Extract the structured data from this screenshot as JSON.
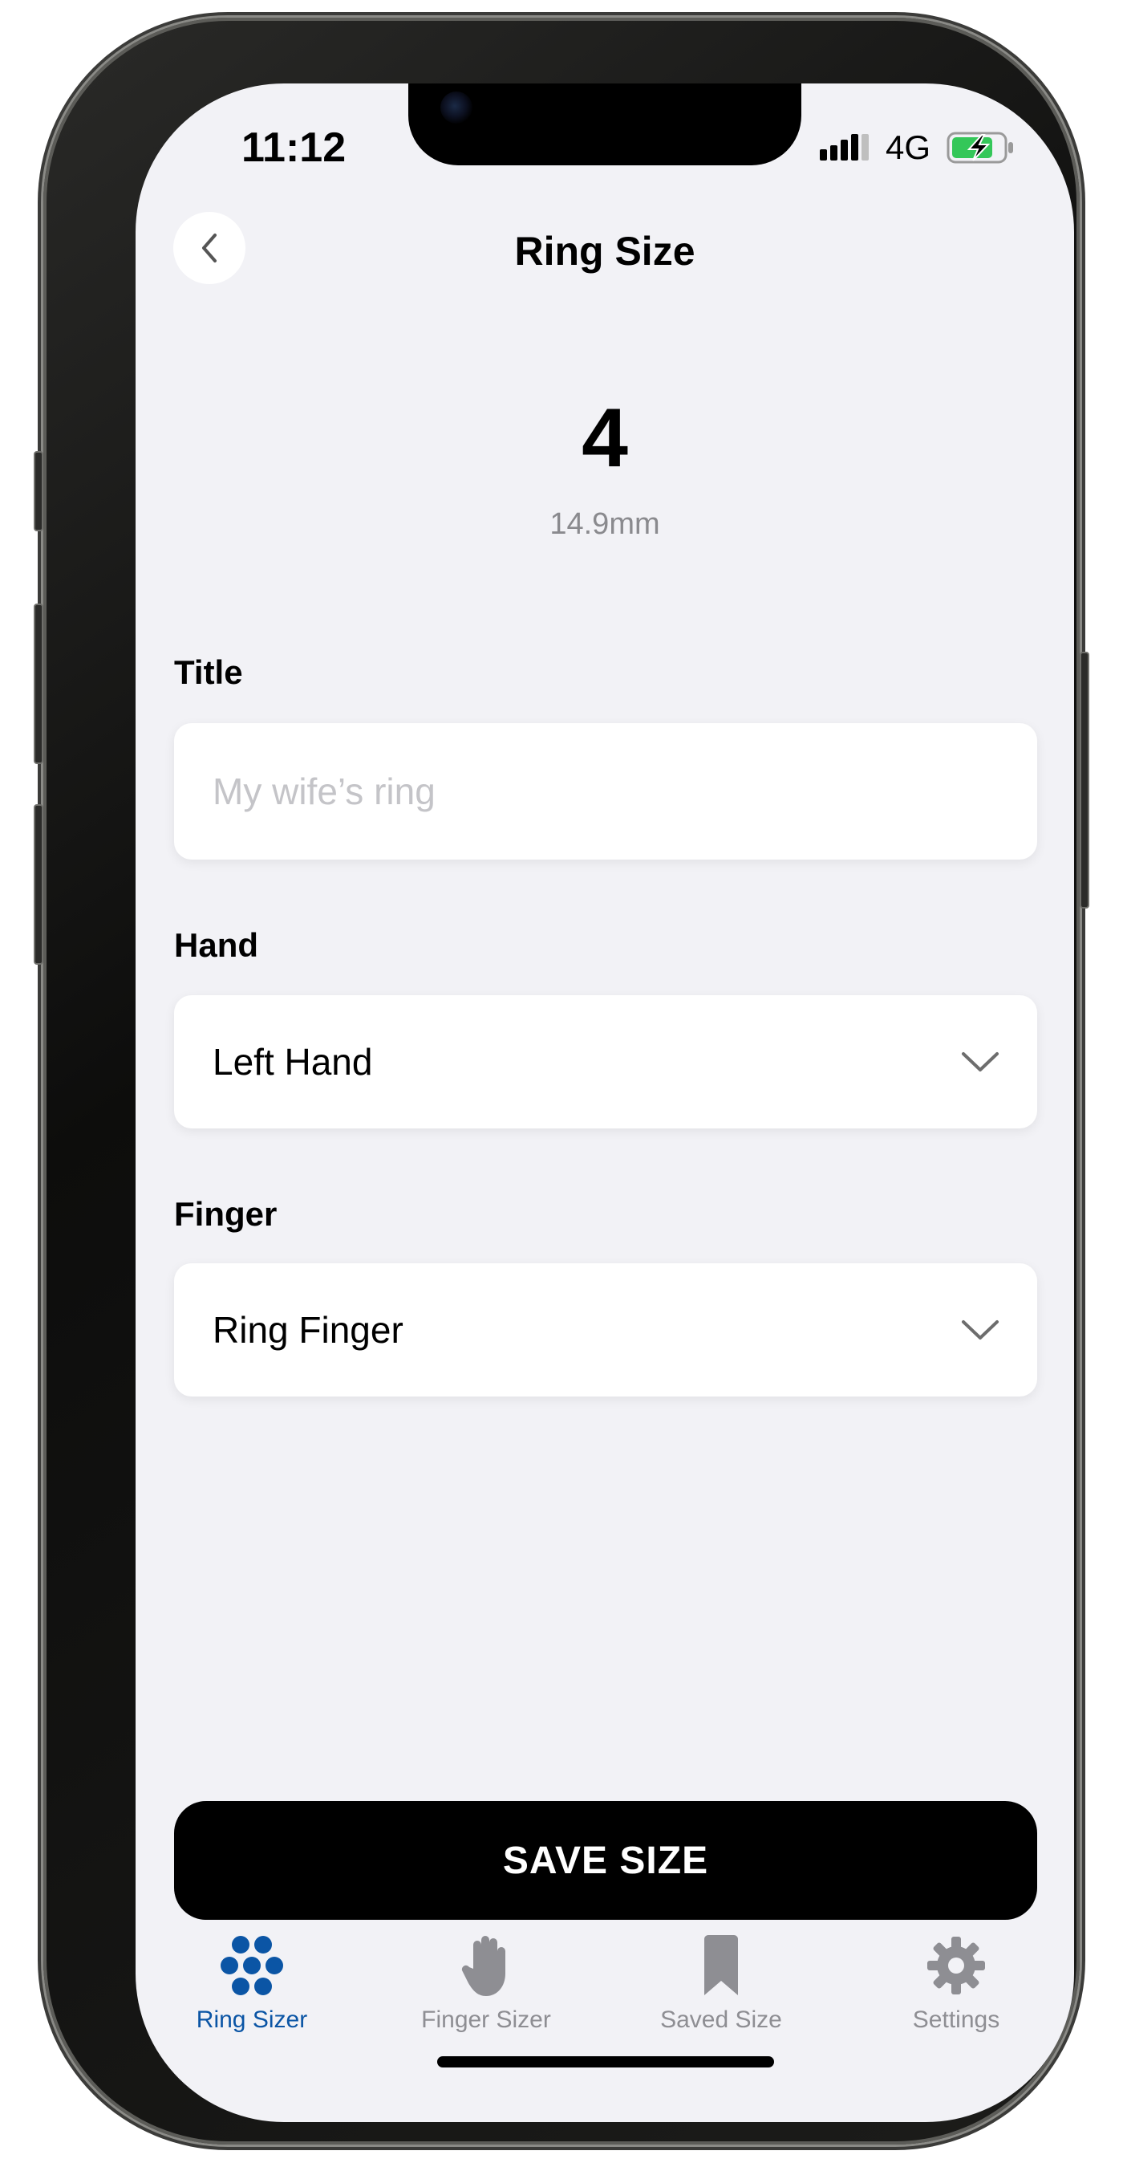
{
  "status_bar": {
    "time": "11:12",
    "network": "4G",
    "signal_icon": "cellular-signal-icon",
    "battery_icon": "battery-charging-icon",
    "battery_color": "#34c759"
  },
  "header": {
    "title": "Ring Size",
    "back_icon": "chevron-left-icon"
  },
  "result": {
    "size": "4",
    "diameter": "14.9mm"
  },
  "form": {
    "title_label": "Title",
    "title_placeholder": "My wife’s ring",
    "title_value": "",
    "hand_label": "Hand",
    "hand_value": "Left Hand",
    "finger_label": "Finger",
    "finger_value": "Ring Finger"
  },
  "save_button": "SAVE SIZE",
  "tab_bar": {
    "active_color": "#0b55a5",
    "inactive_color": "#8e8e93",
    "tabs": [
      {
        "label": "Ring Sizer",
        "icon": "dots-cluster-icon",
        "active": true
      },
      {
        "label": "Finger Sizer",
        "icon": "hand-icon",
        "active": false
      },
      {
        "label": "Saved Size",
        "icon": "bookmark-icon",
        "active": false
      },
      {
        "label": "Settings",
        "icon": "gear-icon",
        "active": false
      }
    ]
  }
}
